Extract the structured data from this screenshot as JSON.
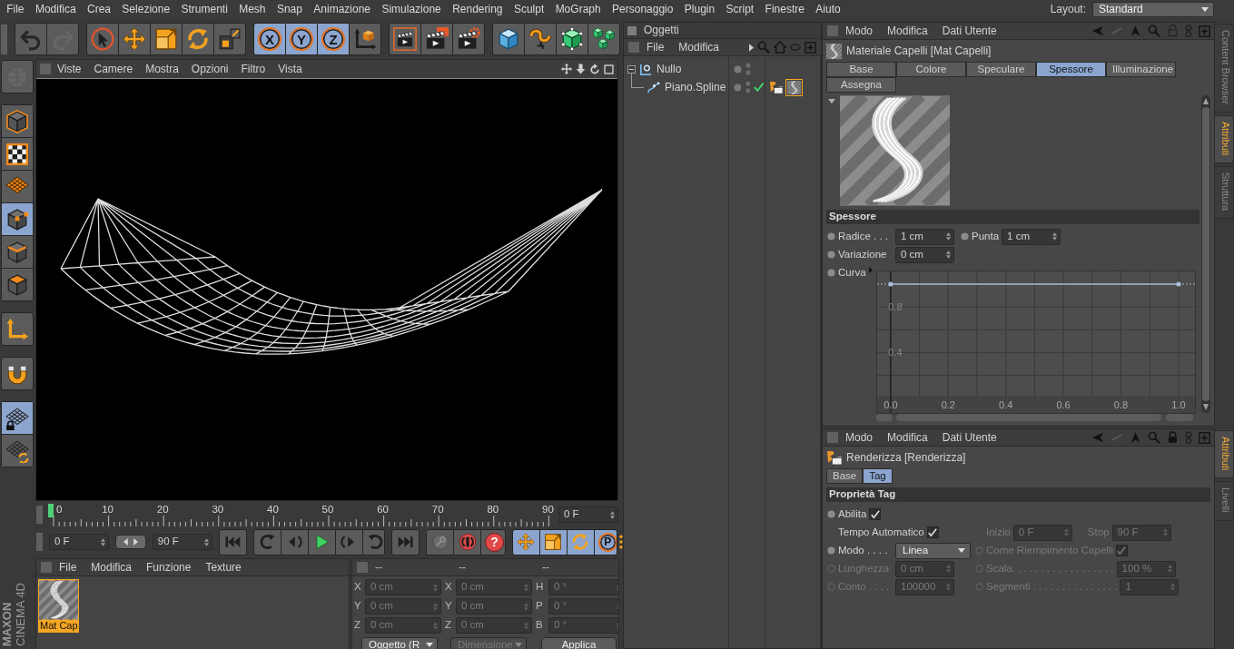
{
  "menu_bar": {
    "items": [
      "File",
      "Modifica",
      "Crea",
      "Selezione",
      "Strumenti",
      "Mesh",
      "Snap",
      "Animazione",
      "Simulazione",
      "Rendering",
      "Sculpt",
      "MoGraph",
      "Personaggio",
      "Plugin",
      "Script",
      "Finestre",
      "Aiuto"
    ],
    "layout_label": "Layout:",
    "layout_value": "Standard"
  },
  "toolbar": {
    "groups": [
      {
        "buttons": [
          {
            "kind": "undo",
            "on": false,
            "disabled": false
          },
          {
            "kind": "redo",
            "on": false,
            "disabled": true
          }
        ]
      },
      {
        "buttons": [
          {
            "kind": "select",
            "on": false,
            "disabled": false
          },
          {
            "kind": "move",
            "on": false,
            "disabled": false
          },
          {
            "kind": "scale",
            "on": false,
            "disabled": false
          },
          {
            "kind": "rotate",
            "on": false,
            "disabled": false
          },
          {
            "kind": "recent",
            "on": false,
            "disabled": false
          }
        ]
      },
      {
        "buttons": [
          {
            "kind": "ring",
            "label": "X",
            "on": true,
            "disabled": false
          },
          {
            "kind": "ring",
            "label": "Y",
            "on": true,
            "disabled": false
          },
          {
            "kind": "ring",
            "label": "Z",
            "on": true,
            "disabled": false
          },
          {
            "kind": "coords",
            "on": false,
            "disabled": false
          }
        ]
      },
      {
        "buttons": [
          {
            "kind": "renderview",
            "on": false,
            "disabled": false
          },
          {
            "kind": "renderpicture",
            "on": false,
            "disabled": false
          },
          {
            "kind": "rendersettings",
            "on": false,
            "disabled": false
          }
        ]
      },
      {
        "buttons": [
          {
            "kind": "cube",
            "on": false,
            "disabled": false
          },
          {
            "kind": "spline",
            "on": false,
            "disabled": false
          },
          {
            "kind": "generator",
            "on": false,
            "disabled": false
          },
          {
            "kind": "array",
            "on": false,
            "disabled": false
          }
        ]
      }
    ]
  },
  "mode_toolbar": {
    "groups": [
      {
        "buttons": [
          {
            "kind": "editable",
            "on": false,
            "disabled": true
          }
        ]
      },
      {
        "buttons": [
          {
            "kind": "model",
            "on": false,
            "disabled": false
          },
          {
            "kind": "texture",
            "on": false,
            "disabled": false
          },
          {
            "kind": "workplane",
            "on": false,
            "disabled": false
          },
          {
            "kind": "points",
            "on": true,
            "disabled": false
          },
          {
            "kind": "edges",
            "on": false,
            "disabled": false
          },
          {
            "kind": "polygons",
            "on": false,
            "disabled": false
          }
        ]
      },
      {
        "buttons": [
          {
            "kind": "axis",
            "on": false,
            "disabled": false
          }
        ]
      },
      {
        "buttons": [
          {
            "kind": "snap",
            "on": false,
            "disabled": false
          }
        ]
      },
      {
        "buttons": [
          {
            "kind": "lockplane",
            "on": true,
            "disabled": false
          },
          {
            "kind": "planar",
            "on": false,
            "disabled": false
          }
        ]
      }
    ]
  },
  "viewport": {
    "menu": [
      "Viste",
      "Camere",
      "Mostra",
      "Opzioni",
      "Filtro",
      "Vista"
    ]
  },
  "timeline": {
    "ticks": [
      "0",
      "10",
      "20",
      "30",
      "40",
      "50",
      "60",
      "70",
      "80",
      "90"
    ],
    "level": 0,
    "frame": "0 F"
  },
  "transport": {
    "start": "0 F",
    "end": "90 F",
    "groups": [
      {
        "buttons": [
          {
            "kind": "first",
            "on": false
          }
        ]
      },
      {
        "buttons": [
          {
            "kind": "prevkey",
            "on": false
          },
          {
            "kind": "prevframe",
            "on": false
          },
          {
            "kind": "play",
            "on": false
          },
          {
            "kind": "nextframe",
            "on": false
          },
          {
            "kind": "nextkey",
            "on": false
          }
        ]
      },
      {
        "buttons": [
          {
            "kind": "last",
            "on": false
          }
        ]
      },
      {
        "buttons": [
          {
            "kind": "recordkeys",
            "on": false
          },
          {
            "kind": "autokey",
            "on": false
          },
          {
            "kind": "disc",
            "label": "?",
            "on": false
          }
        ]
      },
      {
        "buttons": [
          {
            "kind": "move",
            "on": true
          },
          {
            "kind": "scale",
            "on": true
          },
          {
            "kind": "rotate",
            "on": true
          },
          {
            "kind": "ring",
            "label": "P",
            "on": true
          }
        ]
      }
    ]
  },
  "material_manager": {
    "menu": [
      "File",
      "Modifica",
      "Funzione",
      "Texture"
    ],
    "materials": [
      {
        "name": "Mat Cap",
        "selected": true
      }
    ]
  },
  "coordinates": {
    "headers": [
      "--",
      "--",
      "--"
    ],
    "rows": [
      {
        "cells": [
          {
            "axis": "X",
            "value": "0 cm"
          },
          {
            "axis": "X",
            "value": "0 cm"
          },
          {
            "axis": "H",
            "value": "0 °"
          }
        ]
      },
      {
        "cells": [
          {
            "axis": "Y",
            "value": "0 cm"
          },
          {
            "axis": "Y",
            "value": "0 cm"
          },
          {
            "axis": "P",
            "value": "0 °"
          }
        ]
      },
      {
        "cells": [
          {
            "axis": "Z",
            "value": "0 cm"
          },
          {
            "axis": "Z",
            "value": "0 cm"
          },
          {
            "axis": "B",
            "value": "0 °"
          }
        ]
      }
    ],
    "controls": [
      {
        "kind": "dropdown",
        "label": "Oggetto (R",
        "disabled": false
      },
      {
        "kind": "dropdown",
        "label": "Dimensione",
        "disabled": true
      },
      {
        "kind": "button",
        "label": "Applica",
        "disabled": false
      }
    ]
  },
  "logo": {
    "brand": "MAXON",
    "product": "CINEMA 4D"
  },
  "objects": {
    "title": "Oggetti",
    "menu": [
      "File",
      "Modifica"
    ],
    "tree": [
      {
        "name": "Nullo",
        "kind": "null",
        "expanded": true,
        "checked": false,
        "children": [
          {
            "name": "Piano.Spline",
            "kind": "spline",
            "checked": true,
            "tags": [
              {
                "kind": "render",
                "selected": false
              },
              {
                "kind": "material",
                "selected": true
              }
            ]
          }
        ]
      }
    ]
  },
  "attributes": {
    "menu": [
      "Modo",
      "Modifica",
      "Dati Utente"
    ],
    "locked": false,
    "title": "Materiale Capelli [Mat Capelli]",
    "tabs": [
      {
        "label": "Base",
        "selected": false
      },
      {
        "label": "Colore",
        "selected": false
      },
      {
        "label": "Speculare",
        "selected": false
      },
      {
        "label": "Spessore",
        "selected": true
      },
      {
        "label": "Illuminazione",
        "selected": false
      },
      {
        "label": "Assegna",
        "selected": false
      }
    ],
    "section": "Spessore",
    "rows": [
      {
        "fields": [
          {
            "kind": "number",
            "label": "Radice . . .",
            "value": "1 cm",
            "keyframe_dot": true
          },
          {
            "kind": "number",
            "label": "Punta",
            "value": "1 cm",
            "keyframe_dot": true
          }
        ]
      },
      {
        "fields": [
          {
            "kind": "number",
            "label": "Variazione",
            "value": "0 cm",
            "keyframe_dot": true
          }
        ]
      }
    ],
    "curve": {
      "label": "Curva",
      "keyframe_dot": true,
      "chart_data": {
        "type": "line",
        "x": [
          0,
          1
        ],
        "values": [
          1,
          1
        ],
        "xlim": [
          -0.05,
          1.06
        ],
        "ylim": [
          -0.14,
          1.12
        ],
        "grid": true,
        "xticks": [
          {
            "value": 0,
            "label": "0.0"
          },
          {
            "value": 0.2,
            "label": "0.2"
          },
          {
            "value": 0.4,
            "label": "0.4"
          },
          {
            "value": 0.6,
            "label": "0.6"
          },
          {
            "value": 0.8,
            "label": "0.8"
          },
          {
            "value": 1,
            "label": "1.0"
          }
        ],
        "yticks": [
          0.4,
          0.8
        ]
      }
    }
  },
  "tag_attributes": {
    "menu": [
      "Modo",
      "Modifica",
      "Dati Utente"
    ],
    "locked": true,
    "title": "Renderizza [Renderizza]",
    "tabs": [
      {
        "label": "Base",
        "selected": false
      },
      {
        "label": "Tag",
        "selected": true
      }
    ],
    "section": "Proprietà Tag",
    "rows": [
      {
        "fields": [
          {
            "kind": "check",
            "label": "Abilita",
            "checked": true,
            "keyframe_dot": true,
            "disabled": false
          }
        ]
      },
      {
        "fields": [
          {
            "kind": "check",
            "label": "Tempo Automatico",
            "checked": true,
            "keyframe_dot": false,
            "disabled": false
          },
          {
            "kind": "number",
            "label": "Inizio",
            "value": "0 F",
            "keyframe_dot": false,
            "disabled": true
          },
          {
            "kind": "number",
            "label": "Stop",
            "value": "90 F",
            "keyframe_dot": false,
            "disabled": true
          }
        ]
      },
      {
        "fields": [
          {
            "kind": "select",
            "label": "Modo . . . .",
            "value": "Linea",
            "keyframe_dot": true,
            "disabled": false
          },
          {
            "kind": "check",
            "label": "Come Riempimento Capelli",
            "checked": true,
            "keyframe_dot": true,
            "disabled": true
          }
        ]
      },
      {
        "fields": [
          {
            "kind": "number",
            "label": "Lunghezza",
            "value": "0 cm",
            "keyframe_dot": true,
            "disabled": true
          },
          {
            "kind": "number",
            "label": "Scala. . . . . . . . . . . . . . . . . .",
            "value": "100 %",
            "keyframe_dot": true,
            "disabled": true
          }
        ]
      },
      {
        "fields": [
          {
            "kind": "number",
            "label": "Conto . . . .",
            "value": "100000",
            "keyframe_dot": true,
            "disabled": true
          },
          {
            "kind": "number",
            "label": "Segmenti . . . . . . . . . . . . . . .",
            "value": "1",
            "keyframe_dot": true,
            "disabled": true
          }
        ]
      }
    ]
  },
  "side_tabs": {
    "upper": [
      {
        "label": "Content Browser",
        "selected": false
      },
      {
        "label": "Attributi",
        "selected": true
      },
      {
        "label": "Struttura",
        "selected": false
      }
    ],
    "lower": [
      {
        "label": "Attributi",
        "selected": true
      },
      {
        "label": "Livelli",
        "selected": false
      }
    ]
  }
}
